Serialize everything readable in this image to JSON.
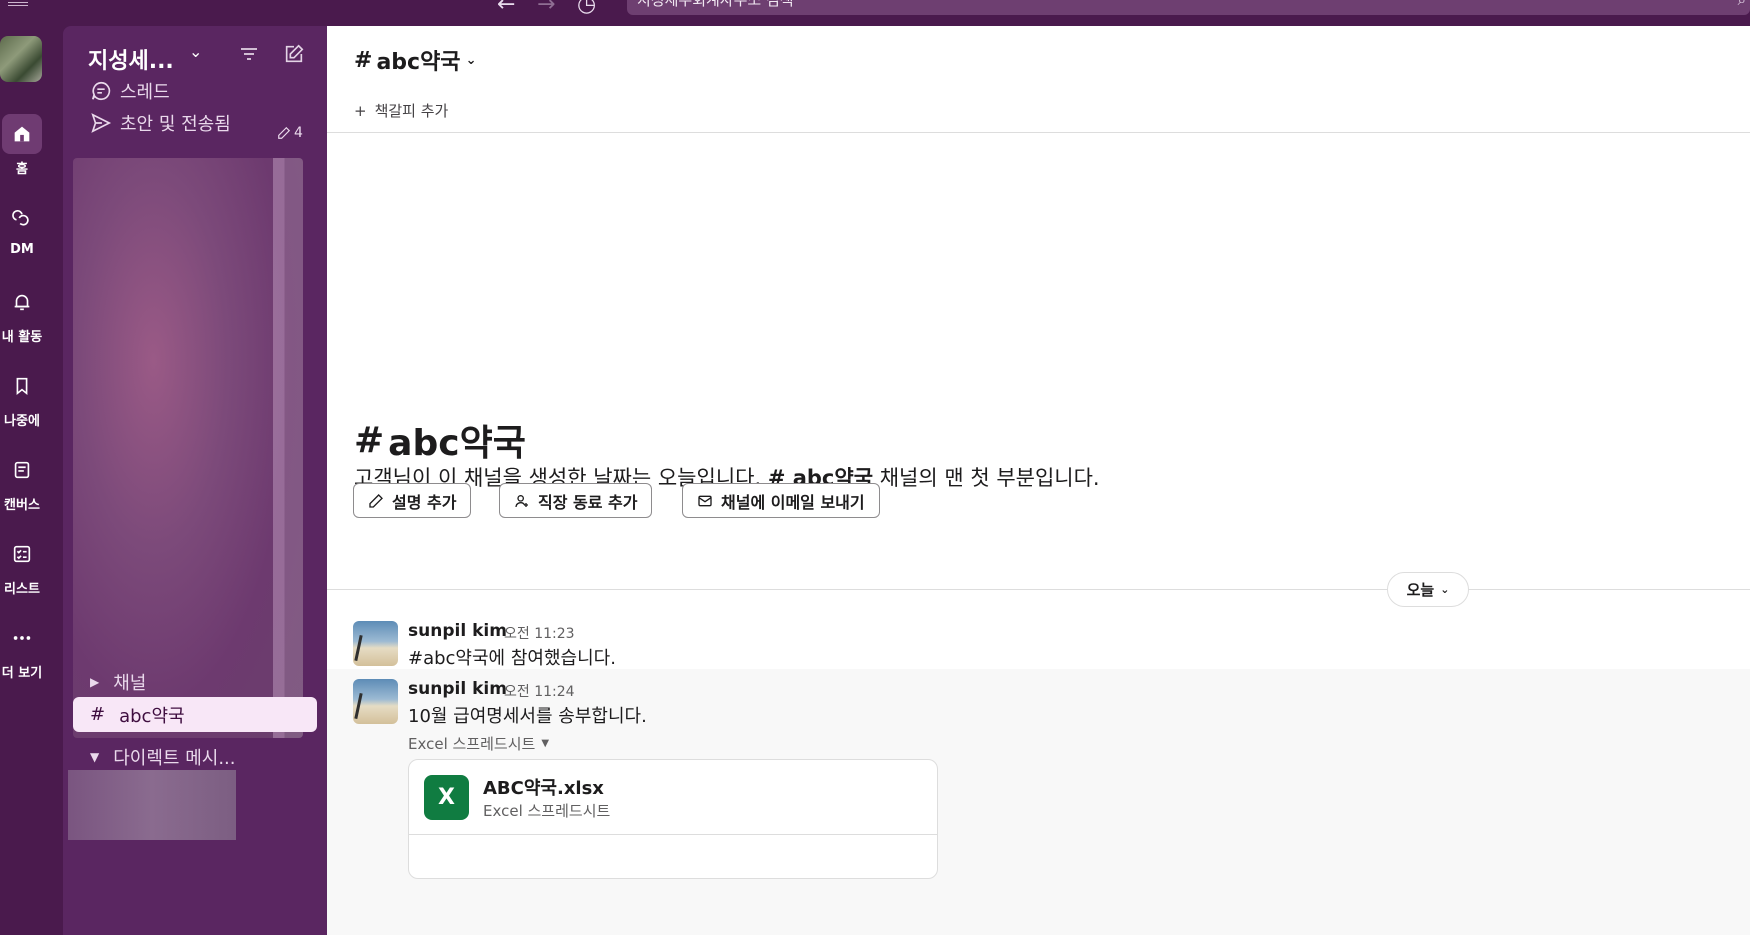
{
  "topbar": {
    "back_icon": "←",
    "forward_icon": "→",
    "history_icon": "◷",
    "search_text": "지성세무회계사무소 검색",
    "search_icon": "⌕"
  },
  "rail": {
    "items": [
      {
        "label": "홈",
        "icon": "home-icon",
        "active": true
      },
      {
        "label": "DM",
        "icon": "dm-icon",
        "active": false
      },
      {
        "label": "내 활동",
        "icon": "bell-icon",
        "active": false
      },
      {
        "label": "나중에",
        "icon": "bookmark-icon",
        "active": false
      },
      {
        "label": "캔버스",
        "icon": "canvas-icon",
        "active": false
      },
      {
        "label": "리스트",
        "icon": "list-icon",
        "active": false
      },
      {
        "label": "더 보기",
        "icon": "more-icon",
        "active": false
      }
    ]
  },
  "sidebar": {
    "workspace_name": "지성세...",
    "threads_label": "스레드",
    "drafts_label": "초안 및 전송됨",
    "drafts_count": "4",
    "channels_section": "채널",
    "active_channel": "abc약국",
    "dm_section": "다이렉트 메시..."
  },
  "channel": {
    "name": "abc약국",
    "add_bookmark": "책갈피 추가",
    "intro_title": "abc약국",
    "intro_prefix": "고객님이 이 채널을 생성한 날짜는 오늘입니다. ",
    "intro_channel": "# abc약국",
    "intro_suffix": " 채널의 맨 첫 부분입니다.",
    "buttons": {
      "add_description": "설명 추가",
      "add_coworker": "직장 동료 추가",
      "send_email": "채널에 이메일 보내기"
    },
    "day_label": "오늘"
  },
  "messages": [
    {
      "author": "sunpil kim",
      "time": "오전 11:23",
      "text": "#abc약국에 참여했습니다."
    },
    {
      "author": "sunpil kim",
      "time": "오전 11:24",
      "text": "10월 급여명세서를 송부합니다.",
      "attachment": {
        "meta": "Excel 스프레드시트",
        "filename": "ABC약국.xlsx",
        "filetype": "Excel 스프레드시트",
        "badge": "X"
      }
    }
  ],
  "colors": {
    "aubergine": "#4a1a4d",
    "sidebar": "#5a2661",
    "active_channel_bg": "#f8e7f7",
    "excel_green": "#107c41"
  }
}
